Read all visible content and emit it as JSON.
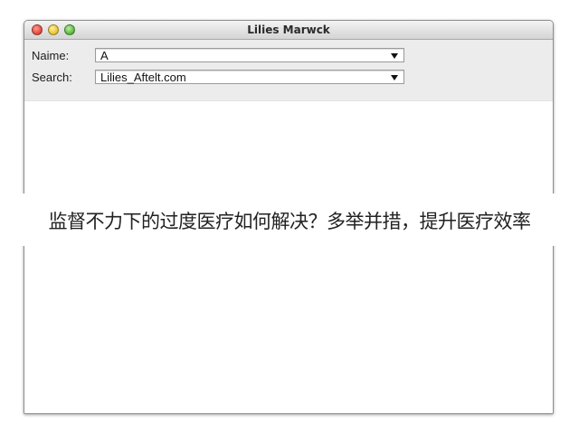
{
  "window": {
    "title": "Lilies Marwck"
  },
  "form": {
    "name_label": "Naime:",
    "name_value": "A",
    "search_label": "Search:",
    "search_value": "Lilies_Aftelt.com"
  },
  "overlay": {
    "caption": "监督不力下的过度医疗如何解决？多举并措，提升医疗效率"
  },
  "colors": {
    "close": "#e0443a",
    "minimize": "#e8c12a",
    "zoom": "#56b43a"
  }
}
